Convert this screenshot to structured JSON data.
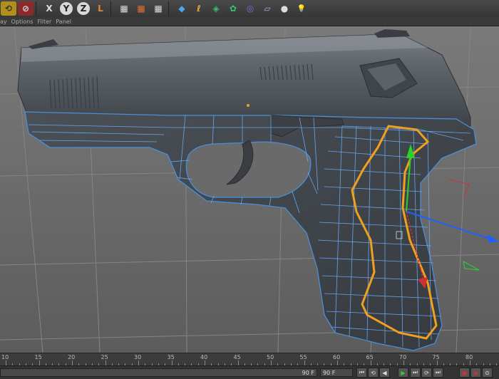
{
  "toolbar": {
    "items": [
      {
        "name": "undo-icon",
        "glyph": "⟲"
      },
      {
        "name": "redo-icon",
        "glyph": "⊘"
      },
      {
        "name": "lock-x-axis-icon",
        "glyph": "X"
      },
      {
        "name": "lock-y-axis-icon",
        "glyph": "Y"
      },
      {
        "name": "lock-z-axis-icon",
        "glyph": "Z"
      },
      {
        "name": "coordinate-system-icon",
        "glyph": "L"
      },
      {
        "name": "render-view-icon",
        "glyph": "▦"
      },
      {
        "name": "render-to-picture-viewer-icon",
        "glyph": "▦"
      },
      {
        "name": "render-settings-icon",
        "glyph": "▦"
      },
      {
        "name": "cube-icon",
        "glyph": "◆"
      },
      {
        "name": "spline-pen-icon",
        "glyph": "ℓ"
      },
      {
        "name": "subdivision-surface-icon",
        "glyph": "◈"
      },
      {
        "name": "array-icon",
        "glyph": "✿"
      },
      {
        "name": "deformer-icon",
        "glyph": "◎"
      },
      {
        "name": "floor-icon",
        "glyph": "▱"
      },
      {
        "name": "camera-icon",
        "glyph": "●"
      },
      {
        "name": "light-icon",
        "glyph": "💡"
      }
    ]
  },
  "menu": [
    "ay",
    "Options",
    "Filter",
    "Panel"
  ],
  "timeline": {
    "ticks": [
      "10",
      "15",
      "20",
      "25",
      "30",
      "35",
      "40",
      "45",
      "50",
      "55",
      "60",
      "65",
      "70",
      "75",
      "80"
    ],
    "current_frame": "90 F",
    "end_frame": "90 F"
  },
  "colors": {
    "viewport": "#6f6f6f",
    "wire": "#6ab0ff",
    "selection": "#f0a020",
    "axis_y": "#2bd02b",
    "axis_x": "#2060ff"
  }
}
